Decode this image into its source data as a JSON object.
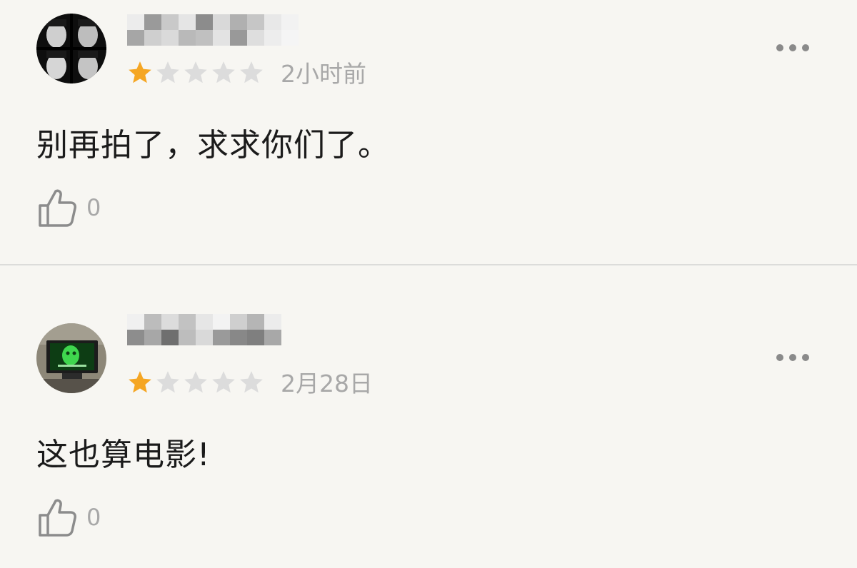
{
  "reviews": [
    {
      "rating": 1,
      "max_rating": 5,
      "time": "2小时前",
      "content": "别再拍了，求求你们了。",
      "likes": "0",
      "avatar_icon": "portrait-photo"
    },
    {
      "rating": 1,
      "max_rating": 5,
      "time": "2月28日",
      "content": "这也算电影!",
      "likes": "0",
      "avatar_icon": "monitor-photo"
    }
  ],
  "colors": {
    "background": "#f7f6f2",
    "star_filled": "#f5a623",
    "star_empty": "#dcdcdc",
    "text_primary": "#1b1b1b",
    "text_secondary": "#a8a8a8"
  }
}
